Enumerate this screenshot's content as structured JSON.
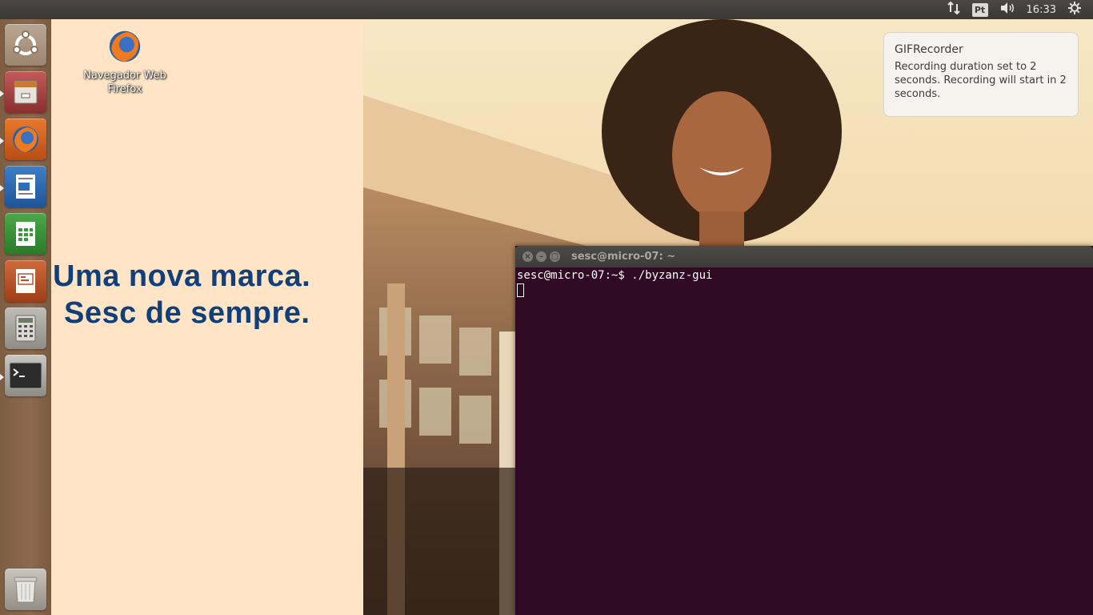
{
  "top_panel": {
    "keyboard_indicator": "Pt",
    "clock": "16:33",
    "icons": [
      "network-icon",
      "keyboard-layout-icon",
      "volume-icon",
      "session-gear-icon"
    ]
  },
  "launcher": {
    "items": [
      {
        "name": "dash-ubuntu-icon"
      },
      {
        "name": "files-icon",
        "running": true
      },
      {
        "name": "firefox-icon",
        "running": true
      },
      {
        "name": "libreoffice-writer-icon",
        "running": true
      },
      {
        "name": "libreoffice-calc-icon"
      },
      {
        "name": "libreoffice-impress-icon"
      },
      {
        "name": "calculator-icon"
      },
      {
        "name": "terminal-icon",
        "running": true
      },
      {
        "name": "trash-icon"
      }
    ]
  },
  "desktop": {
    "icon_label_line1": "Navegador Web",
    "icon_label_line2": "Firefox",
    "slogan_line1": "Uma nova marca.",
    "slogan_line2": "Sesc de sempre."
  },
  "notification": {
    "title": "GIFRecorder",
    "body": "Recording duration set to 2 seconds. Recording will start in 2 seconds."
  },
  "terminal": {
    "title": "sesc@micro-07: ~",
    "prompt_line": "sesc@micro-07:~$ ./byzanz-gui"
  },
  "colors": {
    "terminal_bg": "#300a24",
    "desktop_left_bg": "#ffe4c5",
    "slogan": "#103f7a",
    "launcher_bg": "#8c6a4e"
  }
}
